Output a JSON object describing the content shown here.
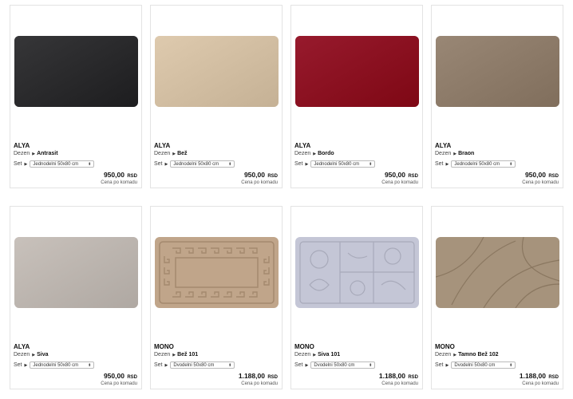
{
  "products": [
    {
      "name": "ALYA",
      "dezen_label": "Dezen",
      "dezen": "Antrasit",
      "set_label": "Set",
      "set": "Jednodelni 50x80 cm",
      "price": "950,00",
      "currency": "RSD",
      "unit": "Cena po komadu",
      "rug_color": "#2b2b2d",
      "pattern": "plain"
    },
    {
      "name": "ALYA",
      "dezen_label": "Dezen",
      "dezen": "Bež",
      "set_label": "Set",
      "set": "Jednodelni 50x80 cm",
      "price": "950,00",
      "currency": "RSD",
      "unit": "Cena po komadu",
      "rug_color": "#d3bfa3",
      "pattern": "plain"
    },
    {
      "name": "ALYA",
      "dezen_label": "Dezen",
      "dezen": "Bordo",
      "set_label": "Set",
      "set": "Jednodelni 50x80 cm",
      "price": "950,00",
      "currency": "RSD",
      "unit": "Cena po komadu",
      "rug_color": "#8c0f22",
      "pattern": "plain"
    },
    {
      "name": "ALYA",
      "dezen_label": "Dezen",
      "dezen": "Braon",
      "set_label": "Set",
      "set": "Jednodelni 50x80 cm",
      "price": "950,00",
      "currency": "RSD",
      "unit": "Cena po komadu",
      "rug_color": "#8e7c6a",
      "pattern": "plain"
    },
    {
      "name": "ALYA",
      "dezen_label": "Dezen",
      "dezen": "Siva",
      "set_label": "Set",
      "set": "Jednodelni 50x80 cm",
      "price": "950,00",
      "currency": "RSD",
      "unit": "Cena po komadu",
      "rug_color": "#bdb6b0",
      "pattern": "plain"
    },
    {
      "name": "MONO",
      "dezen_label": "Dezen",
      "dezen": "Bež 101",
      "set_label": "Set",
      "set": "Dvodelni 50x80 cm",
      "price": "1.188,00",
      "currency": "RSD",
      "unit": "Cena po komadu",
      "rug_color": "#c0a58a",
      "pattern": "greek"
    },
    {
      "name": "MONO",
      "dezen_label": "Dezen",
      "dezen": "Siva 101",
      "set_label": "Set",
      "set": "Dvodelni 50x80 cm",
      "price": "1.188,00",
      "currency": "RSD",
      "unit": "Cena po komadu",
      "rug_color": "#c4c6d6",
      "pattern": "floral"
    },
    {
      "name": "MONO",
      "dezen_label": "Dezen",
      "dezen": "Tamno Bež 102",
      "set_label": "Set",
      "set": "Dvodelni 50x80 cm",
      "price": "1.188,00",
      "currency": "RSD",
      "unit": "Cena po komadu",
      "rug_color": "#a6937c",
      "pattern": "swirl"
    }
  ]
}
